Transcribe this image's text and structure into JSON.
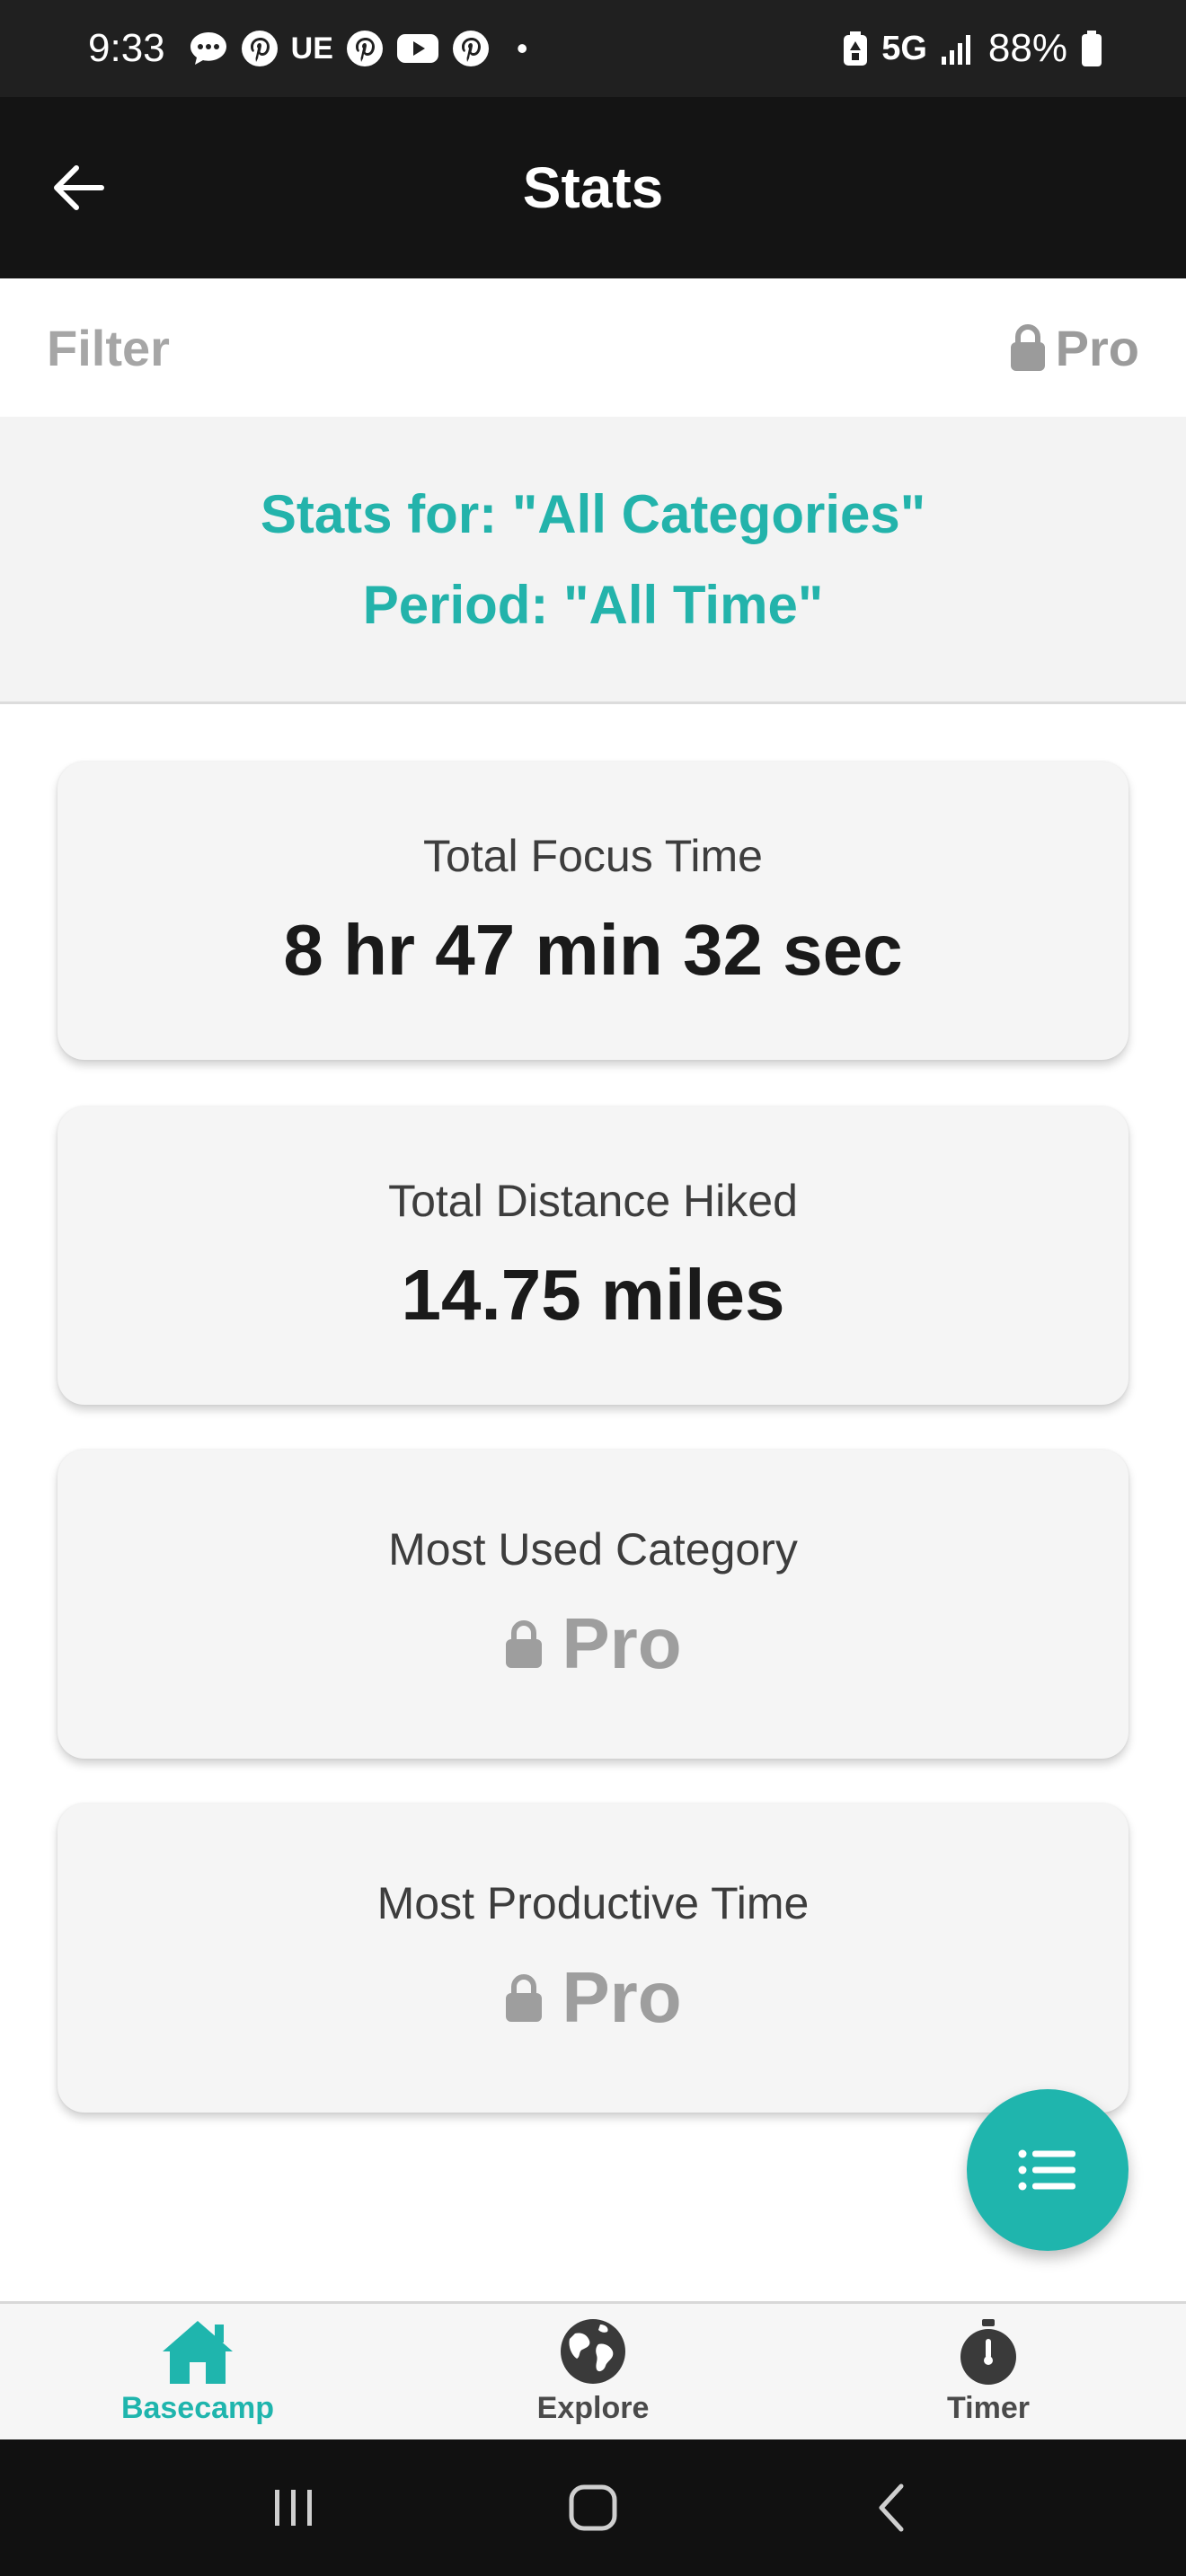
{
  "status_bar": {
    "time": "9:33",
    "carrier_text": "UE",
    "dot": "•",
    "network": "5G",
    "battery": "88%",
    "icons": [
      "chat-icon",
      "pinterest-icon",
      "pinterest-icon",
      "youtube-icon",
      "pinterest-icon",
      "battery-saver-icon",
      "signal-icon",
      "battery-icon"
    ]
  },
  "app_bar": {
    "title": "Stats",
    "back_icon": "arrow-left-icon"
  },
  "filter": {
    "label": "Filter",
    "pro_label": "Pro",
    "pro_icon": "lock-icon"
  },
  "stats_header": {
    "category_line": "Stats for: \"All Categories\"",
    "period_line": "Period: \"All Time\""
  },
  "cards": [
    {
      "label": "Total Focus Time",
      "value": "8 hr 47 min 32 sec"
    },
    {
      "label": "Total Distance Hiked",
      "value": "14.75 miles"
    },
    {
      "label": "Most Used Category",
      "value": "Pro",
      "locked": true
    },
    {
      "label": "Most Productive Time",
      "value": "Pro",
      "locked": true
    }
  ],
  "fab": {
    "icon": "list-icon"
  },
  "bottom_nav": {
    "items": [
      {
        "label": "Basecamp",
        "icon": "home-icon",
        "active": true
      },
      {
        "label": "Explore",
        "icon": "globe-icon",
        "active": false
      },
      {
        "label": "Timer",
        "icon": "stopwatch-icon",
        "active": false
      }
    ]
  },
  "colors": {
    "accent": "#1fb5ad",
    "header_text": "#23b3ab",
    "app_bar": "#141414",
    "status_bar": "#202020",
    "locked_gray": "#9e9e9e"
  }
}
